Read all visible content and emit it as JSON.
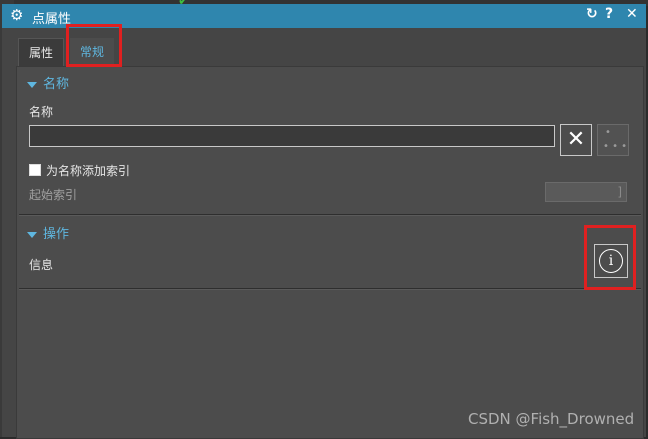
{
  "dialog": {
    "title": "点属性",
    "icon": "gear-icon",
    "title_buttons": {
      "refresh": "↻",
      "help": "?",
      "close": "✕"
    }
  },
  "tabs": [
    {
      "label": "属性",
      "active": false
    },
    {
      "label": "常规",
      "active": true
    }
  ],
  "section_name": {
    "title": "名称",
    "name_label": "名称",
    "name_value": "",
    "clear_button": "✕",
    "add_index_label": "为名称添加索引",
    "add_index_checked": false,
    "start_index_label": "起始索引",
    "start_index_value": ""
  },
  "section_ops": {
    "title": "操作",
    "info_label": "信息",
    "info_icon_glyph": "i"
  },
  "watermark": "CSDN @Fish_Drowned",
  "colors": {
    "accent": "#2f86ae",
    "tab_active": "#5fb7e0",
    "highlight": "#e02020"
  }
}
